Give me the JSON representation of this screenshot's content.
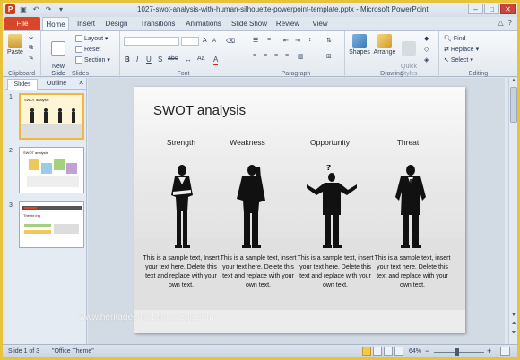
{
  "window": {
    "app_icon": "P",
    "title": "1027-swot-analysis-with-human-silhouette-powerpoint-template.pptx - Microsoft PowerPoint",
    "controls": [
      "minimize-icon",
      "maximize-icon",
      "close-icon"
    ]
  },
  "tabs": {
    "file": "File",
    "items": [
      "Home",
      "Insert",
      "Design",
      "Transitions",
      "Animations",
      "Slide Show",
      "Review",
      "View"
    ],
    "active": "Home"
  },
  "ribbon": {
    "clipboard": {
      "paste": "Paste",
      "label": "Clipboard"
    },
    "slides": {
      "new_slide": "New\nSlide",
      "layout": "Layout",
      "reset": "Reset",
      "section": "Section",
      "label": "Slides"
    },
    "font": {
      "label": "Font",
      "bold": "B",
      "italic": "I",
      "underline": "U",
      "strike": "S",
      "abc": "abc",
      "grow": "A",
      "shrink": "A",
      "aa": "Aa",
      "color": "A"
    },
    "paragraph": {
      "label": "Paragraph"
    },
    "drawing": {
      "shapes": "Shapes",
      "arrange": "Arrange",
      "quick_styles": "Quick\nStyles",
      "label": "Drawing"
    },
    "editing": {
      "find": "Find",
      "replace": "Replace",
      "select": "Select",
      "label": "Editing"
    }
  },
  "left_pane": {
    "tabs": [
      "Slides",
      "Outline"
    ],
    "active_tab": "Slides",
    "thumbnails": [
      {
        "number": "1",
        "title": "SWOT analysis"
      },
      {
        "number": "2",
        "title": "SWOT analysis"
      },
      {
        "number": "3",
        "title": "Theme.ing"
      }
    ]
  },
  "slide": {
    "title": "SWOT analysis",
    "columns": [
      {
        "heading": "Strength",
        "text": "This is a sample text, Insert your text here. Delete this text and replace with your own text."
      },
      {
        "heading": "Weakness",
        "text": "This is a sample text, insert your text here. Delete this text and replace with your own text."
      },
      {
        "heading": "Opportunity",
        "text": "This is a sample text, insert your text here. Delete this text and replace with your own text."
      },
      {
        "heading": "Threat",
        "text": "This is a sample text, insert your text here. Delete this text and replace with your own text."
      }
    ],
    "watermark": "www.heritagechristiancollege.com"
  },
  "status": {
    "slide": "Slide 1 of 3",
    "theme": "\"Office Theme\"",
    "zoom": "64%",
    "zoom_minus": "−",
    "zoom_plus": "+"
  },
  "colors": {
    "file_tab": "#d9472b",
    "selection": "#f0b73a",
    "window_border": "#e7c23a"
  }
}
